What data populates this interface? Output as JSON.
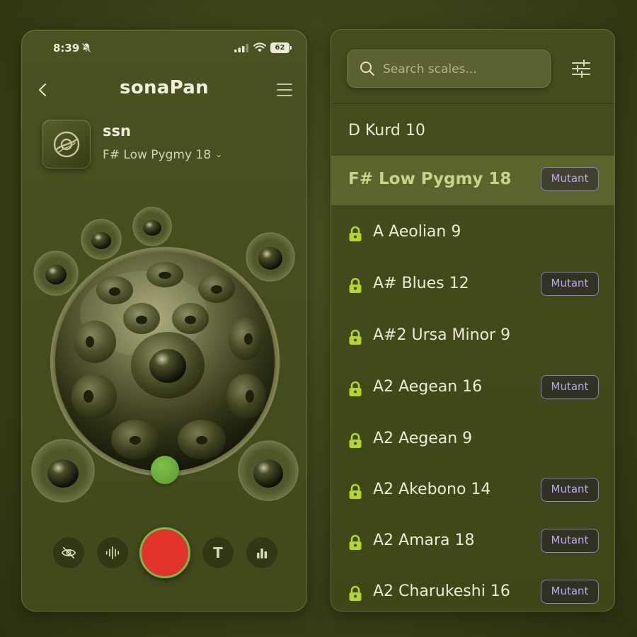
{
  "status": {
    "time": "8:39",
    "battery": "62"
  },
  "header": {
    "title": "sonaPan"
  },
  "instrument": {
    "name": "ssn",
    "scale": "F# Low Pygmy 18"
  },
  "search": {
    "placeholder": "Search scales..."
  },
  "scales": [
    {
      "name": "D Kurd 10",
      "locked": false,
      "mutant": false,
      "selected": false
    },
    {
      "name": "F# Low Pygmy 18",
      "locked": false,
      "mutant": true,
      "selected": true
    },
    {
      "name": "A Aeolian 9",
      "locked": true,
      "mutant": false,
      "selected": false
    },
    {
      "name": "A# Blues 12",
      "locked": true,
      "mutant": true,
      "selected": false
    },
    {
      "name": "A#2 Ursa Minor 9",
      "locked": true,
      "mutant": false,
      "selected": false
    },
    {
      "name": "A2 Aegean 16",
      "locked": true,
      "mutant": true,
      "selected": false
    },
    {
      "name": "A2 Aegean 9",
      "locked": true,
      "mutant": false,
      "selected": false
    },
    {
      "name": "A2 Akebono 14",
      "locked": true,
      "mutant": true,
      "selected": false
    },
    {
      "name": "A2 Amara 18",
      "locked": true,
      "mutant": true,
      "selected": false
    },
    {
      "name": "A2 Charukeshi 16",
      "locked": true,
      "mutant": true,
      "selected": false
    }
  ],
  "badge_label": "Mutant",
  "toolbar": {
    "text_button": "T"
  },
  "colors": {
    "background": "#3f4719",
    "accent_green": "#7bb846",
    "record_red": "#e2322c",
    "selected_text": "#c9d38a",
    "mutant_purple": "#8e7fc2",
    "lock_green": "#b4d62a"
  }
}
